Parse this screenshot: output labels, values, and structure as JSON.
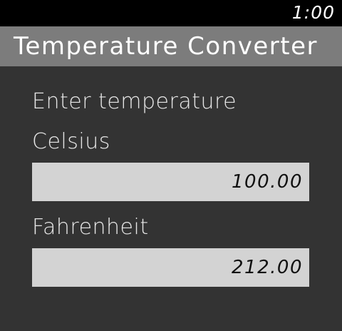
{
  "status": {
    "time": "1:00"
  },
  "header": {
    "title": "Temperature Converter"
  },
  "form": {
    "prompt": "Enter temperature",
    "celsius": {
      "label": "Celsius",
      "value": "100.00"
    },
    "fahrenheit": {
      "label": "Fahrenheit",
      "value": "212.00"
    }
  }
}
